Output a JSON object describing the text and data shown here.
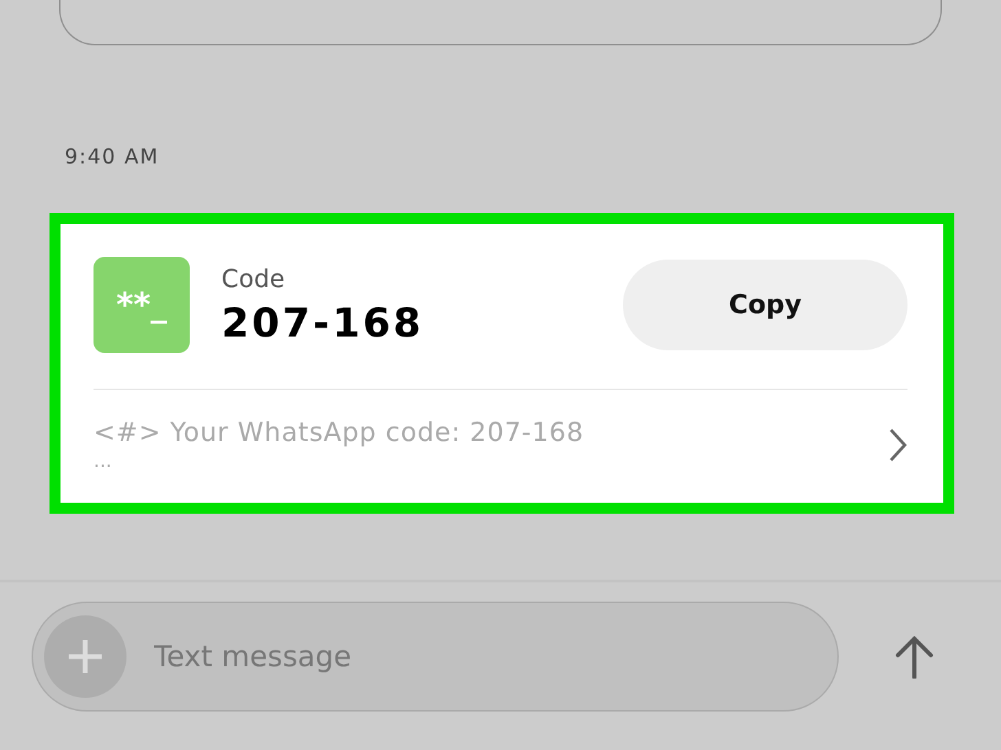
{
  "time": "9:40 AM",
  "code_card": {
    "highlighted": true,
    "icon_text": "**_",
    "label": "Code",
    "code": "207-168",
    "copy_button": "Copy",
    "message": "<#> Your WhatsApp code: 207-168",
    "ellipsis": "..."
  },
  "composer": {
    "placeholder": "Text message"
  }
}
